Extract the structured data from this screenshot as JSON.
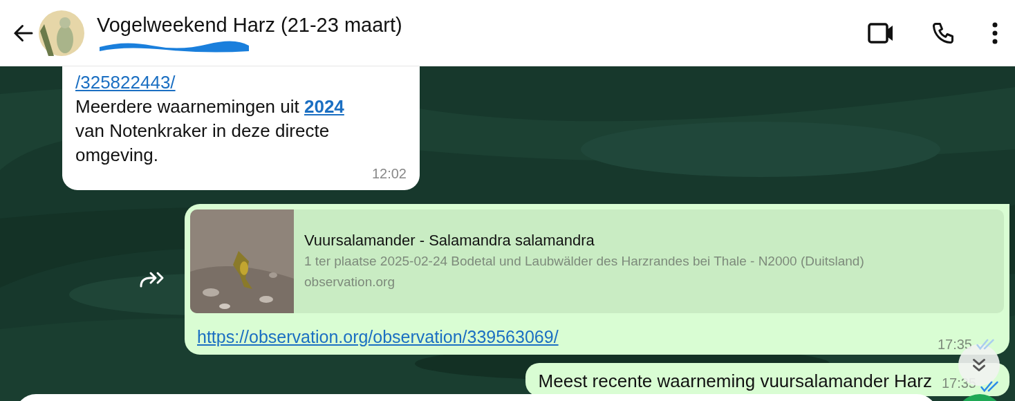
{
  "header": {
    "title": "Vogelweekend Harz (21-23 maart)",
    "subtitle_redacted": true
  },
  "messages": [
    {
      "kind": "incoming",
      "link_top": "/325822443/",
      "body_before": "Meerdere waarnemingen uit ",
      "body_link": "2024",
      "body_after": " van Notenkraker in deze directe omgeving.",
      "time": "12:02"
    },
    {
      "kind": "outgoing_preview",
      "forwardable": true,
      "preview": {
        "title": "Vuursalamander - Salamandra salamandra",
        "description": "1 ter plaatse 2025-02-24 Bodetal und Laubwälder des Harzrandes bei Thale - N2000 (Duitsland)",
        "domain": "observation.org"
      },
      "url": "https://observation.org/observation/339563069/",
      "time": "17:35",
      "read": true
    },
    {
      "kind": "outgoing",
      "text": "Meest recente waarneming vuursalamander Harz",
      "time": "17:35",
      "read": true
    }
  ]
}
